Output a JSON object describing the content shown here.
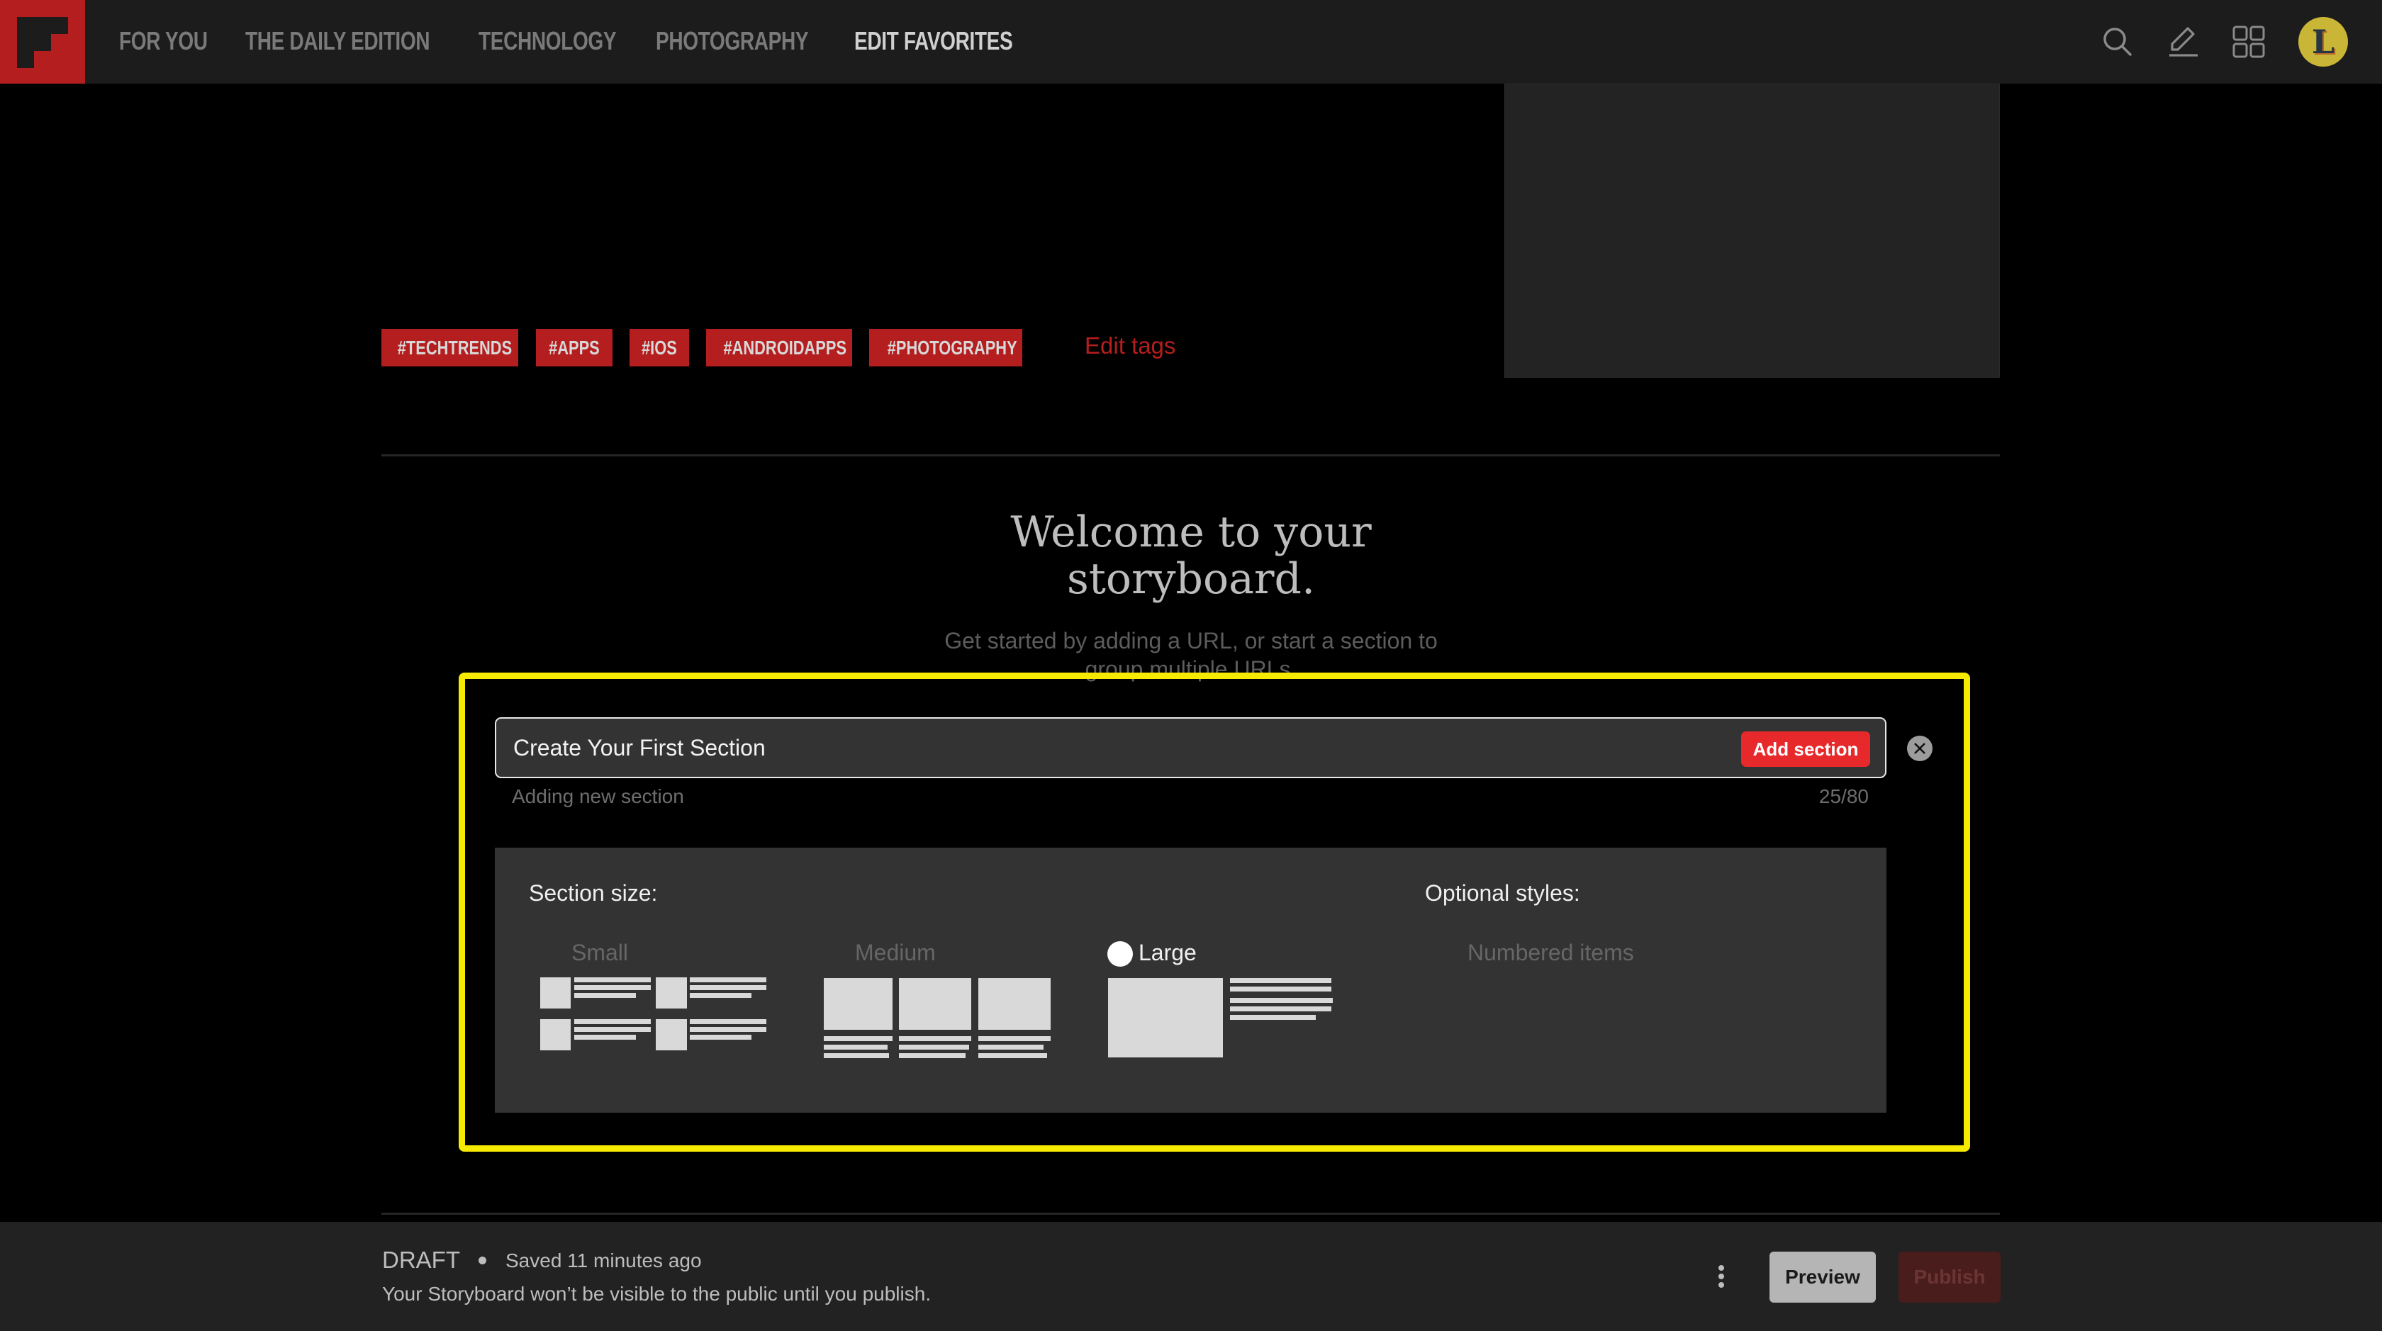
{
  "nav": {
    "items": [
      {
        "label": "FOR YOU",
        "active": false
      },
      {
        "label": "THE DAILY EDITION",
        "active": false
      },
      {
        "label": "TECHNOLOGY",
        "active": false
      },
      {
        "label": "PHOTOGRAPHY",
        "active": false
      },
      {
        "label": "EDIT FAVORITES",
        "active": true
      }
    ],
    "icons": [
      "search-icon",
      "pencil-icon",
      "grid-icon"
    ],
    "avatar_initial": "L"
  },
  "tags": {
    "items": [
      "#TECHTRENDS",
      "#APPS",
      "#IOS",
      "#ANDROIDAPPS",
      "#PHOTOGRAPHY"
    ],
    "edit_label": "Edit tags"
  },
  "welcome": {
    "heading_line1": "Welcome to your",
    "heading_line2": "storyboard.",
    "subtext_line1": "Get started by adding a URL, or start a section to",
    "subtext_line2": "group multiple URLs."
  },
  "section_form": {
    "input_value": "Create Your First Section",
    "add_button": "Add section",
    "hint": "Adding new section",
    "counter": "25/80",
    "section_size_title": "Section size:",
    "sizes": [
      {
        "label": "Small",
        "selected": false
      },
      {
        "label": "Medium",
        "selected": false
      },
      {
        "label": "Large",
        "selected": true
      }
    ],
    "optional_styles_title": "Optional styles:",
    "optional_styles": [
      "Numbered items"
    ]
  },
  "footer": {
    "status": "DRAFT",
    "saved": "Saved 11 minutes ago",
    "notice": "Your Storyboard won’t be visible to the public until you publish.",
    "preview_label": "Preview",
    "publish_label": "Publish"
  },
  "colors": {
    "brand_red": "#b51e1e",
    "button_red": "#e8292b",
    "highlight_yellow": "#f5ea00"
  }
}
